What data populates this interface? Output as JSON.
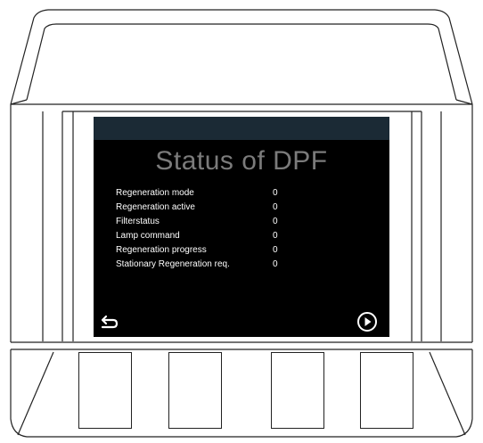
{
  "screen": {
    "title": "Status of DPF",
    "parameters": [
      {
        "label": "Regeneration mode",
        "value": "0"
      },
      {
        "label": "Regeneration active",
        "value": "0"
      },
      {
        "label": "Filterstatus",
        "value": "0"
      },
      {
        "label": "Lamp command",
        "value": "0"
      },
      {
        "label": "Regeneration progress",
        "value": "0"
      },
      {
        "label": "Stationary Regeneration req.",
        "value": "0"
      }
    ]
  },
  "navigation": {
    "back_icon": "return-arrow-icon",
    "next_icon": "circled-play-icon"
  },
  "softkeys": [
    "softkey-1",
    "softkey-2",
    "softkey-3",
    "softkey-4"
  ],
  "colors": {
    "screen_background": "#000000",
    "header_bar": "#1b2a35",
    "title_text": "#7b7b7b",
    "parameter_text": "#ffffff",
    "housing_stroke": "#222222"
  }
}
